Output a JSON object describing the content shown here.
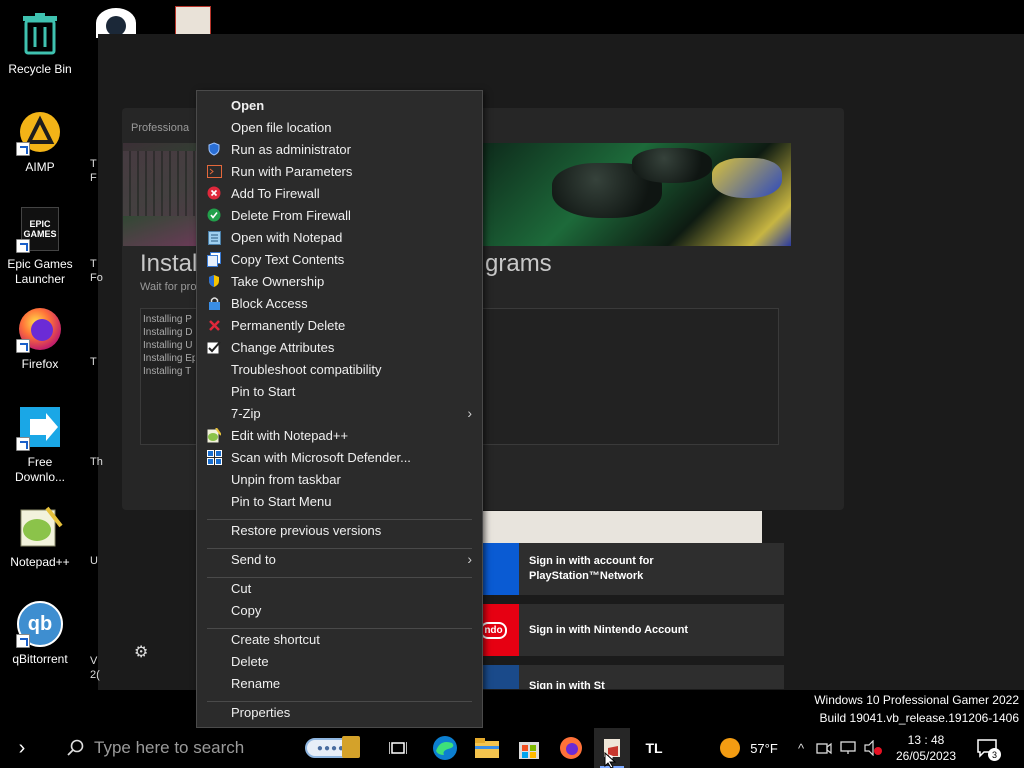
{
  "desktop": {
    "icons": [
      {
        "label": "Recycle Bin"
      },
      {
        "label": "AIMP"
      },
      {
        "label": "Epic Games Launcher",
        "line1": "Epic Games",
        "line2": "Launcher",
        "logo_text": "EPIC\nGAMES"
      },
      {
        "label": "Firefox"
      },
      {
        "label": "Free Downlo...",
        "line1": "Free",
        "line2": "Downlo..."
      },
      {
        "label": "Notepad++"
      },
      {
        "label": "qBittorrent",
        "logo_text": "qb"
      }
    ],
    "partial_labels": [
      "T\nF",
      "T\nFo",
      "T",
      "Th",
      "U",
      "V\n2("
    ]
  },
  "installer": {
    "panel_tag": "Professiona",
    "title_left": "Instal",
    "title_right": "grams",
    "subtitle": "Wait for pro",
    "log_lines": [
      "Installing P",
      "Installing D",
      "Installing U",
      "Installing Ep",
      "Installing T"
    ],
    "accounts": [
      {
        "logo": "",
        "text": "Sign in with account for PlayStation™Network",
        "line1": "Sign in with account for",
        "line2": "PlayStation™Network",
        "color": "#0a5bd3"
      },
      {
        "logo": "ndo",
        "text": "Sign in with Nintendo Account",
        "color": "#e60012"
      },
      {
        "logo": "",
        "text": "Sign in with St",
        "color": "#1a4a8a"
      }
    ]
  },
  "context_menu": {
    "items": [
      {
        "label": "Open",
        "bold": true,
        "icon": ""
      },
      {
        "label": "Open file location",
        "icon": ""
      },
      {
        "label": "Run as administrator",
        "icon": "shield-icon"
      },
      {
        "label": "Run with Parameters",
        "icon": "terminal-icon"
      },
      {
        "label": "Add To Firewall",
        "icon": "firewall-block-icon"
      },
      {
        "label": "Delete From Firewall",
        "icon": "firewall-allow-icon"
      },
      {
        "label": "Open with Notepad",
        "icon": "notepad-icon"
      },
      {
        "label": "Copy Text Contents",
        "icon": "copy-text-icon"
      },
      {
        "label": "Take Ownership",
        "icon": "ownership-shield-icon"
      },
      {
        "label": "Block Access",
        "icon": "lock-icon"
      },
      {
        "label": "Permanently Delete",
        "icon": "delete-x-icon"
      },
      {
        "label": "Change Attributes",
        "icon": "checkbox-icon"
      },
      {
        "label": "Troubleshoot compatibility",
        "icon": ""
      },
      {
        "label": "Pin to Start",
        "icon": ""
      },
      {
        "label": "7-Zip",
        "icon": "",
        "submenu": true
      },
      {
        "label": "Edit with Notepad++",
        "icon": "notepadpp-icon"
      },
      {
        "label": "Scan with Microsoft Defender...",
        "icon": "defender-icon"
      },
      {
        "label": "Unpin from taskbar",
        "icon": ""
      },
      {
        "label": "Pin to Start Menu",
        "icon": ""
      },
      {
        "label": "Restore previous versions",
        "icon": ""
      },
      {
        "label": "Send to",
        "icon": "",
        "submenu": true
      },
      {
        "label": "Cut",
        "icon": ""
      },
      {
        "label": "Copy",
        "icon": ""
      },
      {
        "label": "Create shortcut",
        "icon": ""
      },
      {
        "label": "Delete",
        "icon": ""
      },
      {
        "label": "Rename",
        "icon": ""
      },
      {
        "label": "Properties",
        "icon": ""
      }
    ],
    "submenu_arrow": "›"
  },
  "watermark": {
    "line1": "Windows 10 Professional Gamer 2022",
    "line2": "Build 19041.vb_release.191206-1406"
  },
  "taskbar": {
    "start_arrow": "›",
    "search_placeholder": "Type here to search",
    "weather_temp": "57°F",
    "time": "13 : 48",
    "date": "26/05/2023",
    "notification_count": "3",
    "tl_label": "TL",
    "chevron": "^"
  }
}
